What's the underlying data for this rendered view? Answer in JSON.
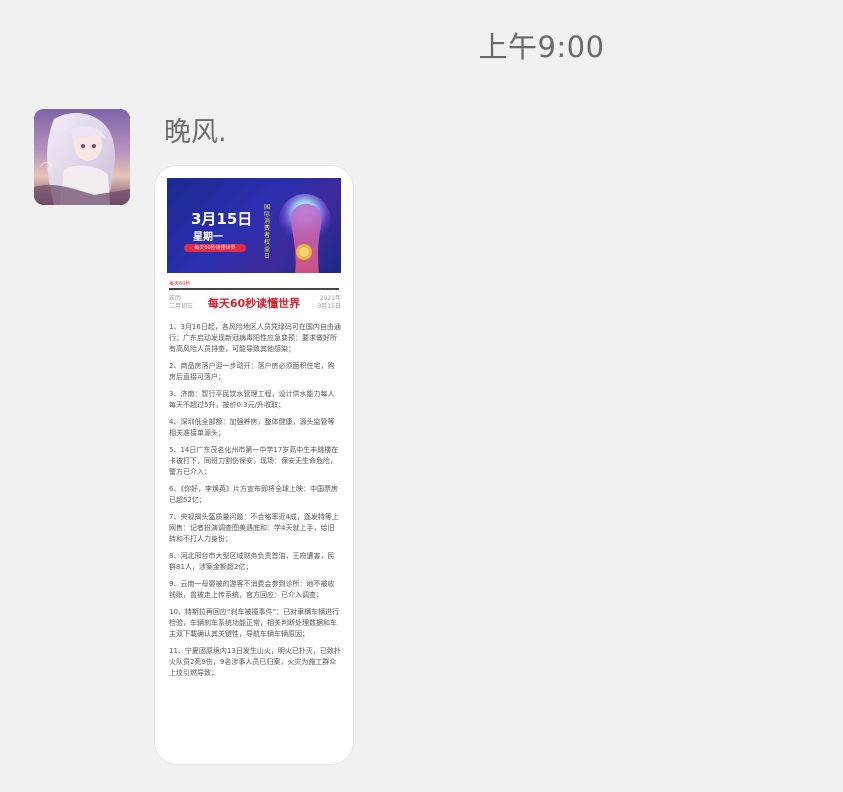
{
  "timestamp": "上午9:00",
  "sender": {
    "name": "晚风."
  },
  "image_message": {
    "banner": {
      "date": "3月15日",
      "weekday": "星期一",
      "pill_text": "每天60秒读懂世界",
      "vertical_text": "国际消费者权益日"
    },
    "sub_tag": "每天60秒",
    "header": {
      "left": "农历\n二月初三",
      "title": "每天60秒读懂世界",
      "right": "2021年\n3月15日"
    },
    "news": [
      "1、3月16日起，各风险地区人员凭绿码可在国内自由通行；广东启动发现新冠病毒阳性应急变预：要求做好所有高风险人员排查，可能导致其他感染；",
      "2、商品房落户迎一步动开：落户房必须面积住宅，购房后直接可落户；",
      "3、济南：暂行平民饮水管理工程，设计供水能力每人每天不超过5升，按价0.3元/升收取；",
      "4、深圳低全部额：加强养房，整体健康，源头监管等相关准接单源头；",
      "5、14日广东茂名化州市第一中学17岁高中生丰跳楼在卡被打下，同班刀割伤保安，现场：保安无生命危险，警方已介入；",
      "6、《你好，李焕英》片方宣布即将全球上映：中国票房已超52亿；",
      "7、央视揭头盔质量问题：不合格率近4成，逐发特等上网售：记者扮演调查图美遇底和：学4天就上手，给旧转和不打人力身份；",
      "8、河北邢台市大型区域财务负责首油，王府遭害，民群81人，涉案金额超2亿；",
      "9、云南一母婴被的游客不消费会参到诊所：地不被收钱账，曾被走上传系统，官方回应：已介入调查；",
      "10、特斯拉再回应“刹车被撞事件”：已对車辆车辆进行检验，车辆刹车系统功能正常，相关判断处理数据和车主双下載确认其关键性，导航车辆车辆原因；",
      "11、宁夏固原境内13日发生山火，明火已扑灭，已致扑火队员2死9伤，9名涉事人员已归案，火灾为施工群众上坟引燃导致；"
    ]
  },
  "colors": {
    "background": "#f1f1f1",
    "card": "#ffffff",
    "headline_red": "#d0222f",
    "banner_blue": "#1f2c96"
  },
  "icons": {
    "avatar": "anime-girl-avatar",
    "fist": "raised-fist-illustration"
  }
}
